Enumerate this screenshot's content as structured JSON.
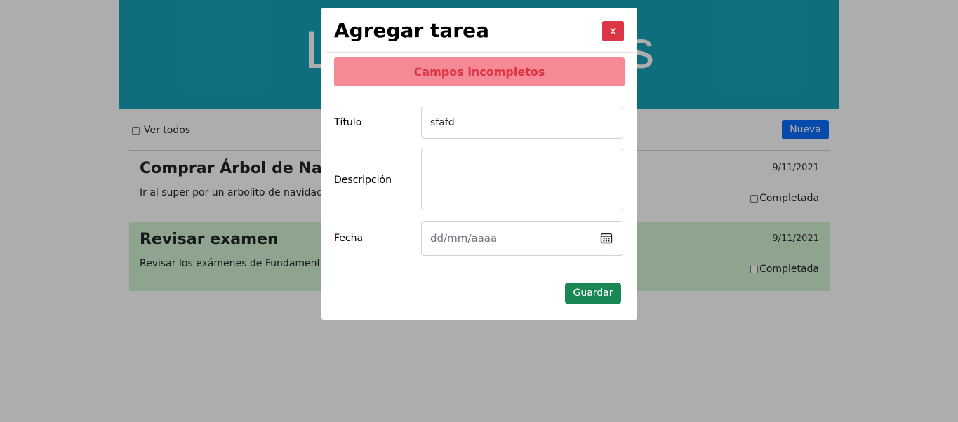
{
  "page": {
    "hero_title": "Lista de tareas",
    "show_all_label": "Ver todos",
    "new_button": "Nueva"
  },
  "tasks": [
    {
      "title": "Comprar Árbol de Navidad",
      "description": "Ir al super por un arbolito de navidad",
      "date": "9/11/2021",
      "completed_label": "Completada"
    },
    {
      "title": "Revisar examen",
      "description": "Revisar los exámenes de Fundamentos",
      "date": "9/11/2021",
      "completed_label": "Completada"
    }
  ],
  "modal": {
    "title": "Agregar tarea",
    "close_label": "x",
    "alert": "Campos incompletos",
    "fields": {
      "title_label": "Título",
      "title_value": "sfafd",
      "description_label": "Descripción",
      "description_value": "",
      "date_label": "Fecha",
      "date_placeholder": "dd/mm/aaaa"
    },
    "save_button": "Guardar"
  },
  "colors": {
    "hero": "#17a2b8",
    "primary": "#0d6efd",
    "danger": "#dc3545",
    "success": "#198754",
    "alert_bg": "#f58a96",
    "completed_row": "#d3f2d3"
  }
}
